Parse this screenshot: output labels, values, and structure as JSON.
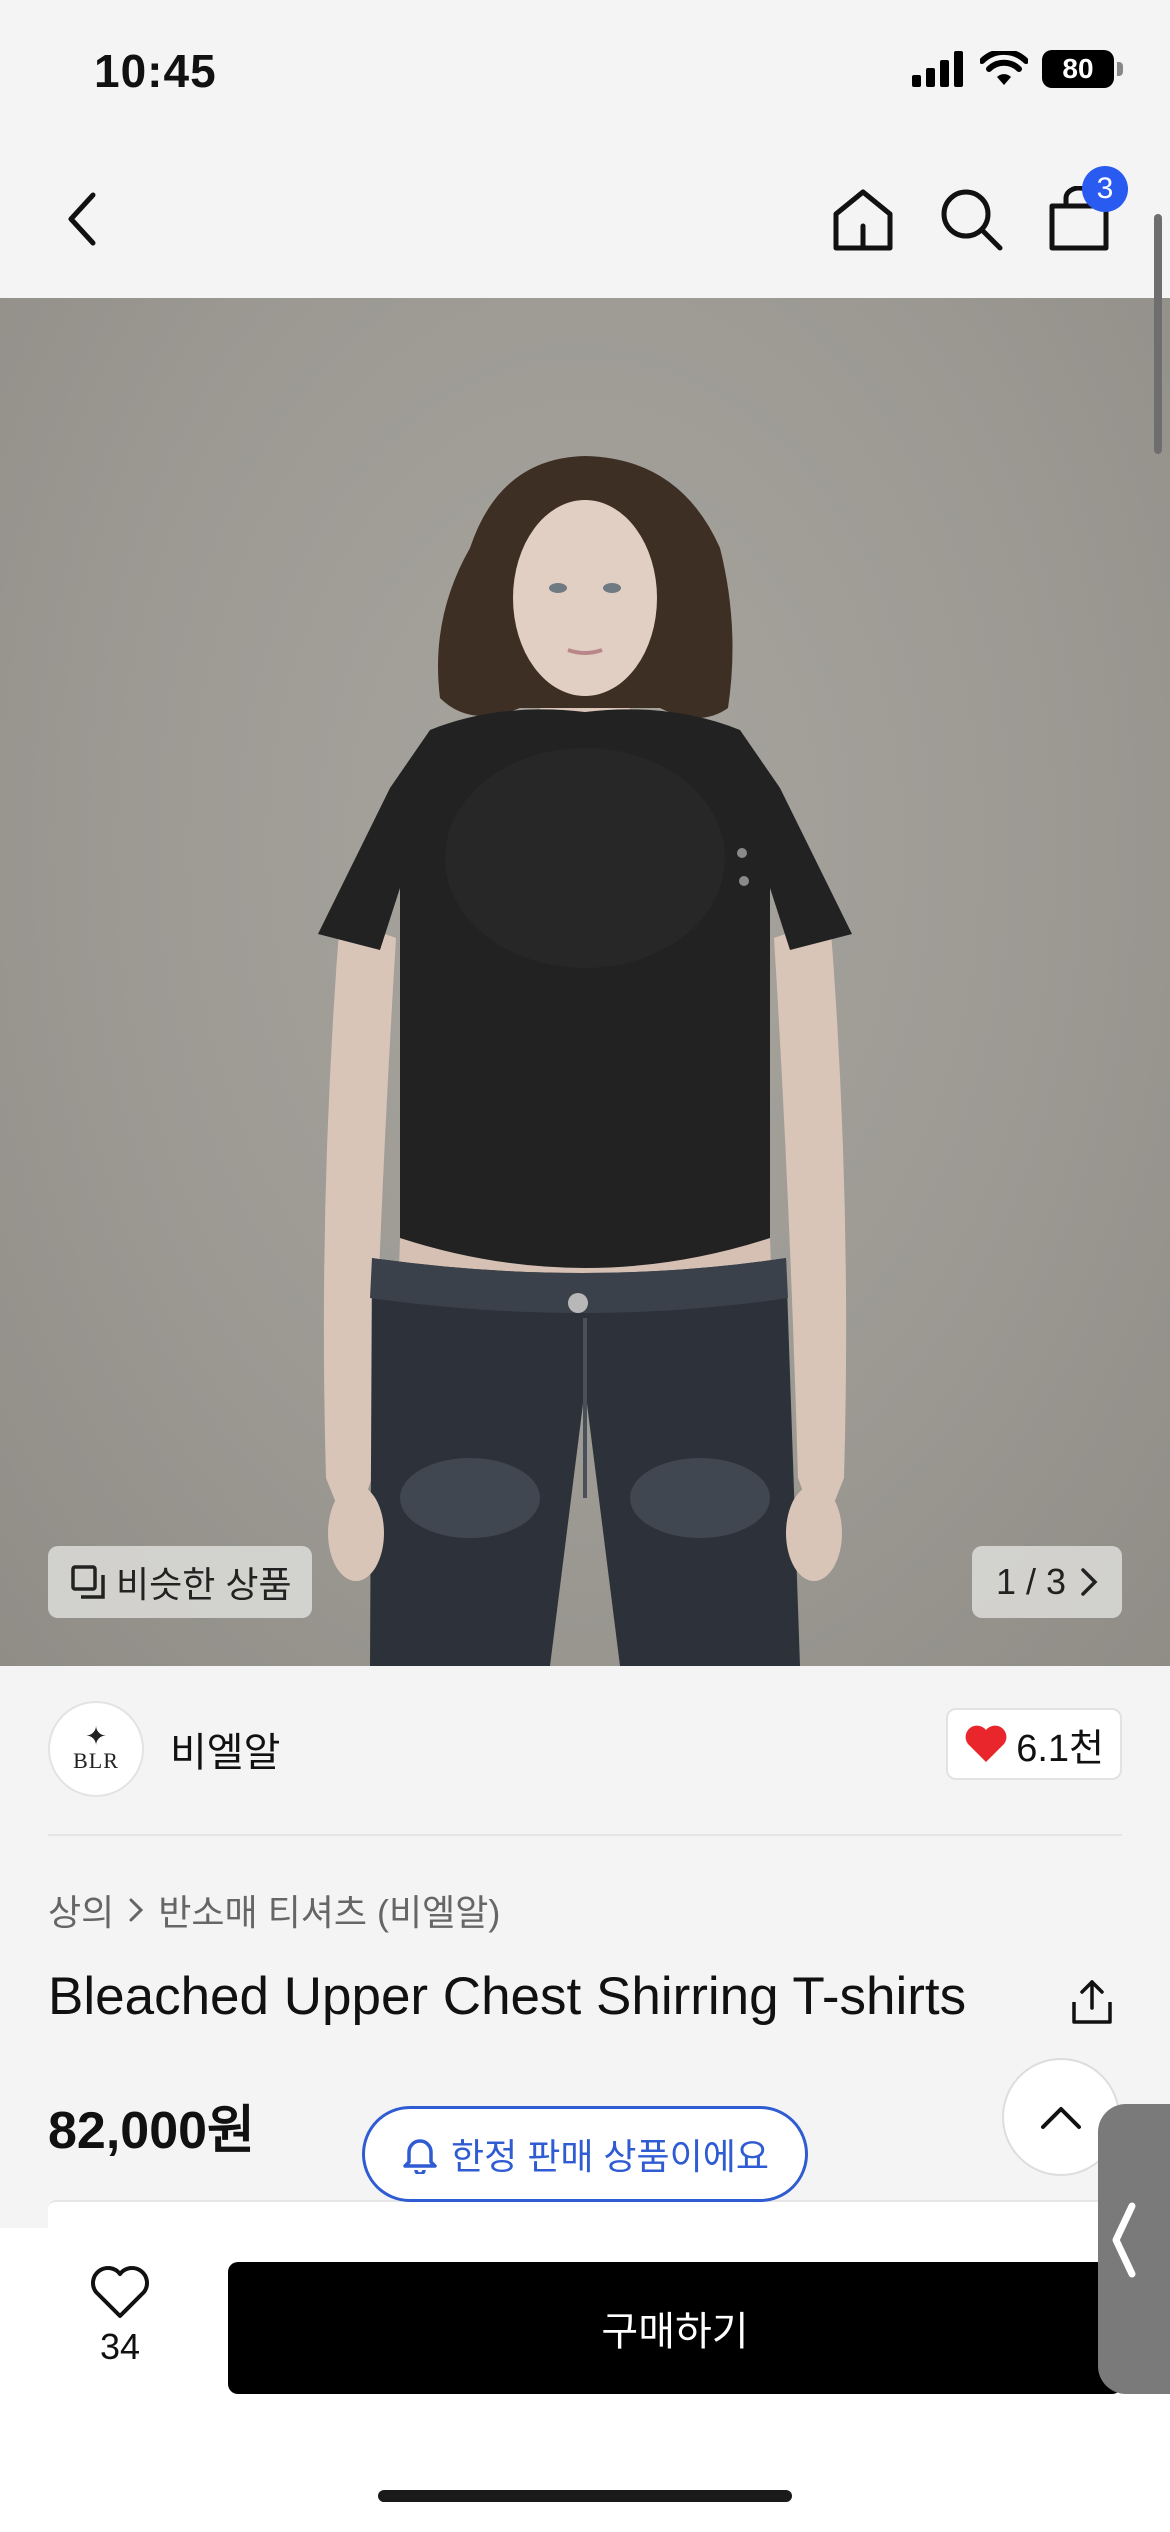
{
  "status_bar": {
    "time": "10:45",
    "battery": "80"
  },
  "nav": {
    "back_icon": "chevron-left-icon",
    "home_icon": "home-icon",
    "search_icon": "search-icon",
    "cart_icon": "shopping-bag-icon",
    "cart_count": "3"
  },
  "hero": {
    "similar_label": "비슷한 상품",
    "pager": "1 / 3",
    "colors": {
      "background": "#9c9a93",
      "shirt": "#1f1f1f",
      "jeans": "#2b2f36"
    }
  },
  "brand": {
    "logo_text": "BLR",
    "name": "비엘알",
    "likes": "6.1천",
    "heart_color": "#e8262b"
  },
  "breadcrumb": {
    "category": "상의",
    "subcategory": "반소매 티셔츠 (비엘알)"
  },
  "product": {
    "title": "Bleached Upper Chest Shirring T-shirts",
    "price": "82,000원"
  },
  "toast": {
    "label": "한정 판매 상품이에요",
    "color": "#2f5cd3"
  },
  "bottom_bar": {
    "wish_count": "34",
    "buy_label": "구매하기"
  }
}
